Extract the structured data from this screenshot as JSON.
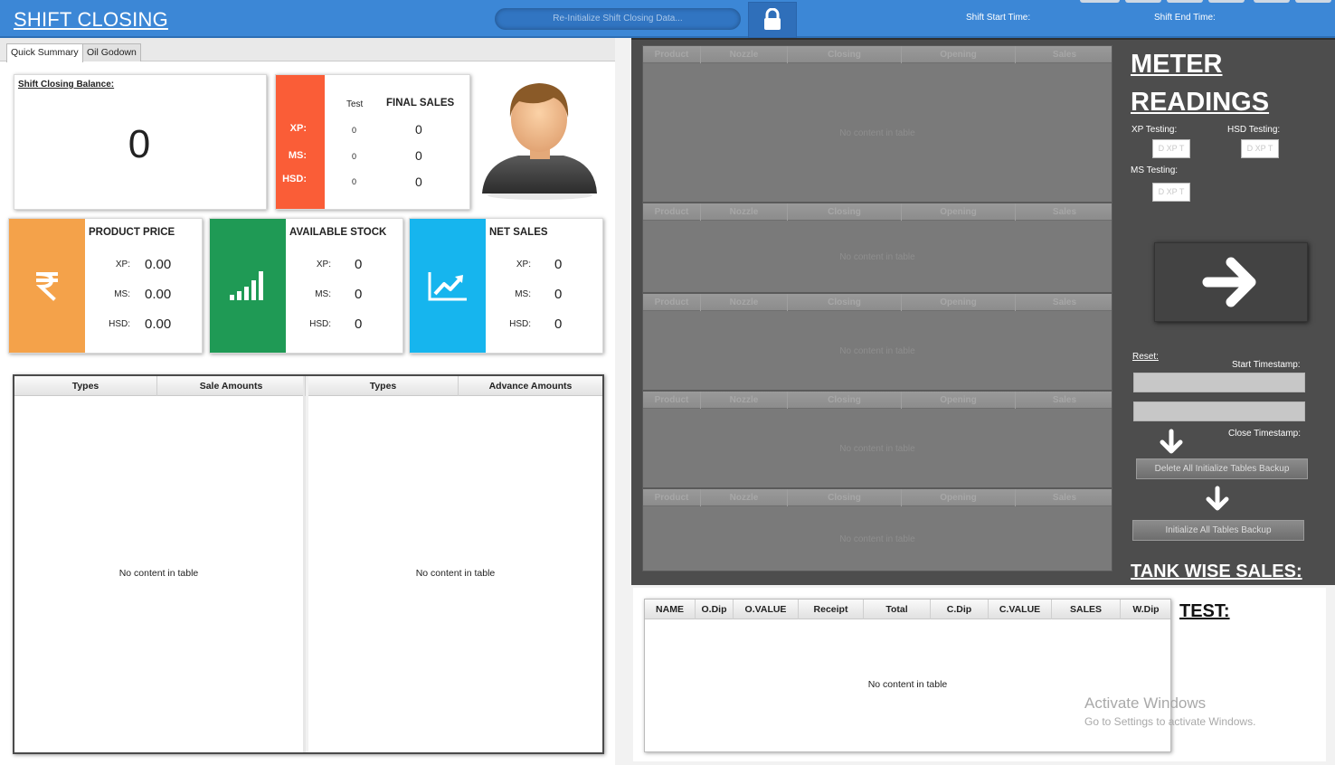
{
  "header": {
    "title": "SHIFT CLOSING",
    "reinit_button": "Re-Initialize Shift Closing Data...",
    "lock_icon": "lock-icon",
    "shift_start_label": "Shift Start Time:",
    "shift_end_label": "Shift End Time:"
  },
  "tabs": [
    {
      "label": "Quick Summary",
      "active": true
    },
    {
      "label": "Oil Godown",
      "active": false
    }
  ],
  "balance": {
    "label": "Shift Closing Balance:",
    "value": "0"
  },
  "final_sales": {
    "color": "#fa5d37",
    "test_header": "Test",
    "sales_header": "FINAL SALES",
    "rows": [
      {
        "label": "XP:",
        "test": "0",
        "sales": "0"
      },
      {
        "label": "MS:",
        "test": "0",
        "sales": "0"
      },
      {
        "label": "HSD:",
        "test": "0",
        "sales": "0"
      }
    ]
  },
  "avatar_icon": "user-avatar-icon",
  "product_price": {
    "title": "PRODUCT PRICE",
    "icon": "rupee-icon",
    "color": "#f4a24a",
    "rows": [
      {
        "label": "XP:",
        "value": "0.00"
      },
      {
        "label": "MS:",
        "value": "0.00"
      },
      {
        "label": "HSD:",
        "value": "0.00"
      }
    ]
  },
  "available_stock": {
    "title": "AVAILABLE STOCK",
    "icon": "signal-bars-icon",
    "color": "#1f9a55",
    "rows": [
      {
        "label": "XP:",
        "value": "0"
      },
      {
        "label": "MS:",
        "value": "0"
      },
      {
        "label": "HSD:",
        "value": "0"
      }
    ]
  },
  "net_sales": {
    "title": "NET SALES",
    "icon": "trend-chart-icon",
    "color": "#16b5ee",
    "rows": [
      {
        "label": "XP:",
        "value": "0"
      },
      {
        "label": "MS:",
        "value": "0"
      },
      {
        "label": "HSD:",
        "value": "0"
      }
    ]
  },
  "sales_table": {
    "columns": [
      "Types",
      "Sale  Amounts"
    ],
    "empty_text": "No content in table"
  },
  "advance_table": {
    "columns": [
      "Types",
      "Advance  Amounts"
    ],
    "empty_text": "No content in table"
  },
  "meter_tables": {
    "columns": [
      "Product",
      "Nozzle",
      "Closing",
      "Opening",
      "Sales"
    ],
    "empty_text": "No content in table"
  },
  "meter_readings": {
    "title_line1": "METER",
    "title_line2": "READINGS",
    "xp_testing_label": "XP Testing:",
    "hsd_testing_label": "HSD Testing:",
    "ms_testing_label": "MS Testing:",
    "xp_placeholder": "D XP T",
    "hsd_placeholder": "D XP T",
    "ms_placeholder": "D XP T",
    "arrow_icon": "arrow-right-icon",
    "reset_label": "Reset:",
    "start_timestamp_label": "Start Timestamp:",
    "close_timestamp_label": "Close Timestamp:",
    "delete_backup_button": "Delete All Initialize Tables Backup",
    "initialize_backup_button": "Initialize All Tables Backup"
  },
  "tank_wise": {
    "title": "TANK WISE SALES:",
    "columns": [
      "NAME",
      "O.Dip",
      "O.VALUE",
      "Receipt",
      "Total",
      "C.Dip",
      "C.VALUE",
      "SALES",
      "W.Dip"
    ],
    "empty_text": "No content in table",
    "test_title": "TEST:"
  },
  "watermark": {
    "line1": "Activate Windows",
    "line2": "Go to Settings to activate Windows."
  }
}
